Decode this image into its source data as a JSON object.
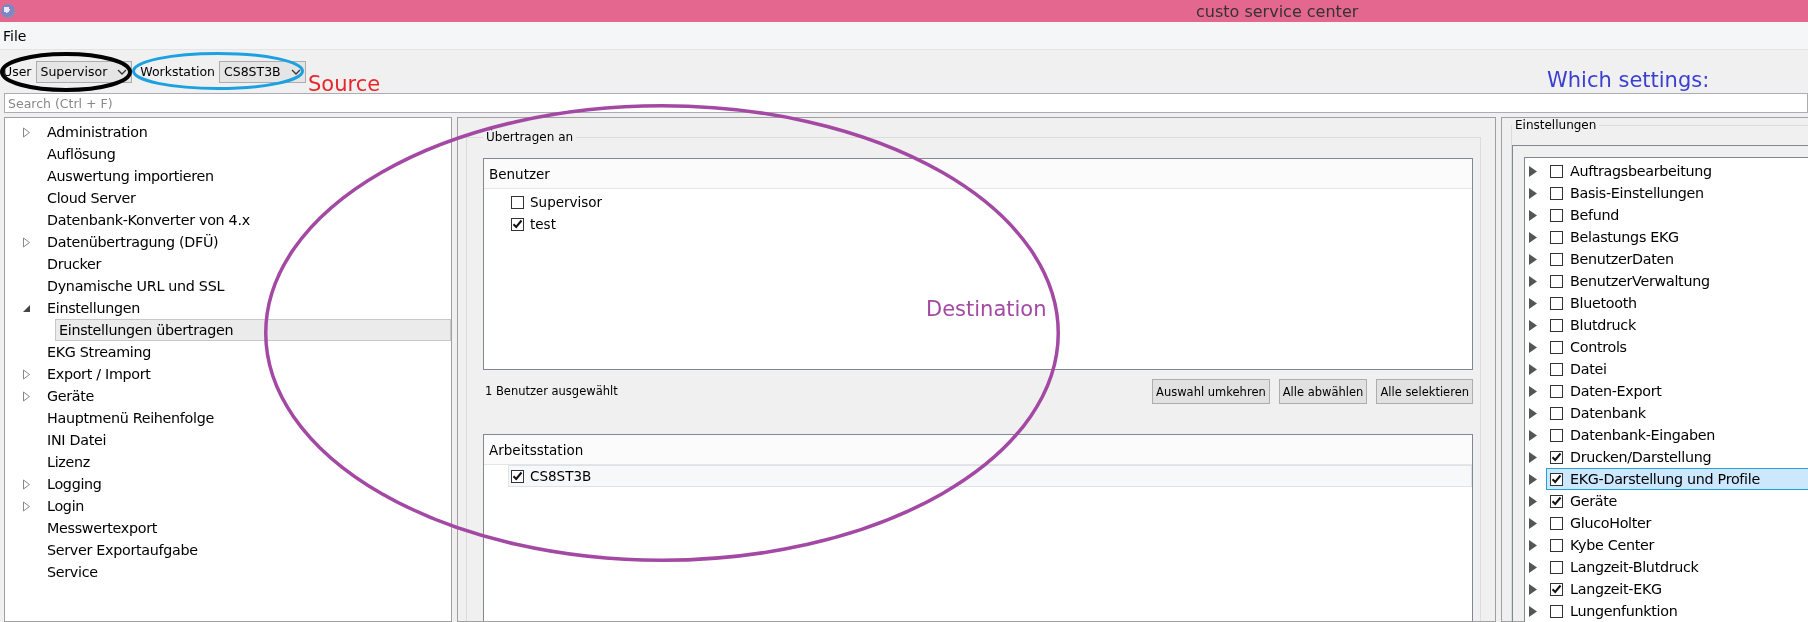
{
  "window": {
    "title": "custo service center"
  },
  "menu": [
    "File"
  ],
  "toolbar": {
    "user_label": "User",
    "user_value": "Supervisor",
    "workstation_label": "Workstation",
    "workstation_value": "CS8ST3B"
  },
  "search": {
    "placeholder": "Search (Ctrl + F)"
  },
  "sidebar": {
    "items": [
      {
        "label": "Administration",
        "expanded": false,
        "selected": false
      },
      {
        "label": "Auflösung",
        "selected": false
      },
      {
        "label": "Auswertung importieren",
        "selected": false
      },
      {
        "label": "Cloud Server",
        "selected": false
      },
      {
        "label": "Datenbank-Konverter von 4.x",
        "selected": false
      },
      {
        "label": "Datenübertragung (DFÜ)",
        "expanded": false,
        "selected": false
      },
      {
        "label": "Drucker",
        "selected": false
      },
      {
        "label": "Dynamische URL und SSL",
        "selected": false
      },
      {
        "label": "Einstellungen",
        "expanded": true,
        "selected": false,
        "children": [
          {
            "label": "Einstellungen übertragen",
            "selected": true
          }
        ]
      },
      {
        "label": "EKG Streaming",
        "selected": false
      },
      {
        "label": "Export / Import",
        "expanded": false,
        "selected": false
      },
      {
        "label": "Geräte",
        "expanded": false,
        "selected": false
      },
      {
        "label": "Hauptmenü Reihenfolge",
        "selected": false
      },
      {
        "label": "INI Datei",
        "selected": false
      },
      {
        "label": "Lizenz",
        "selected": false
      },
      {
        "label": "Logging",
        "expanded": false,
        "selected": false
      },
      {
        "label": "Login",
        "expanded": false,
        "selected": false
      },
      {
        "label": "Messwertexport",
        "selected": false
      },
      {
        "label": "Server Exportaufgabe",
        "selected": false
      },
      {
        "label": "Service",
        "selected": false
      }
    ]
  },
  "transfer": {
    "title": "Übertragen an",
    "users": {
      "header": "Benutzer",
      "items": [
        {
          "label": "Supervisor",
          "checked": false
        },
        {
          "label": "test",
          "checked": true
        }
      ]
    },
    "status": "1 Benutzer ausgewählt",
    "buttons": [
      "Auswahl umkehren",
      "Alle abwählen",
      "Alle selektieren"
    ],
    "workstations": {
      "header": "Arbeitsstation",
      "items": [
        {
          "label": "CS8ST3B",
          "checked": true,
          "selected": true
        }
      ]
    }
  },
  "settings": {
    "title": "Einstellungen",
    "items": [
      {
        "label": "Auftragsbearbeitung",
        "checked": false,
        "selected": false
      },
      {
        "label": "Basis-Einstellungen",
        "checked": false,
        "selected": false
      },
      {
        "label": "Befund",
        "checked": false,
        "selected": false
      },
      {
        "label": "Belastungs EKG",
        "checked": false,
        "selected": false
      },
      {
        "label": "BenutzerDaten",
        "checked": false,
        "selected": false
      },
      {
        "label": "BenutzerVerwaltung",
        "checked": false,
        "selected": false
      },
      {
        "label": "Bluetooth",
        "checked": false,
        "selected": false
      },
      {
        "label": "Blutdruck",
        "checked": false,
        "selected": false
      },
      {
        "label": "Controls",
        "checked": false,
        "selected": false
      },
      {
        "label": "Datei",
        "checked": false,
        "selected": false
      },
      {
        "label": "Daten-Export",
        "checked": false,
        "selected": false
      },
      {
        "label": "Datenbank",
        "checked": false,
        "selected": false
      },
      {
        "label": "Datenbank-Eingaben",
        "checked": false,
        "selected": false
      },
      {
        "label": "Drucken/Darstellung",
        "checked": true,
        "selected": false
      },
      {
        "label": "EKG-Darstellung und Profile",
        "checked": true,
        "selected": true
      },
      {
        "label": "Geräte",
        "checked": true,
        "selected": false
      },
      {
        "label": "GlucoHolter",
        "checked": false,
        "selected": false
      },
      {
        "label": "Kybe Center",
        "checked": false,
        "selected": false
      },
      {
        "label": "Langzeit-Blutdruck",
        "checked": false,
        "selected": false
      },
      {
        "label": "Langzeit-EKG",
        "checked": true,
        "selected": false
      },
      {
        "label": "Lungenfunktion",
        "checked": false,
        "selected": false
      }
    ]
  },
  "annotations": [
    {
      "kind": "ellipse",
      "color": "#000000"
    },
    {
      "kind": "ellipse",
      "color": "#1ba1e2"
    },
    {
      "kind": "text",
      "text": "Source",
      "color": "#e8262a"
    },
    {
      "kind": "text",
      "text": "Which settings:",
      "color": "#3a3fd0"
    },
    {
      "kind": "ellipse",
      "color": "#a349a4"
    },
    {
      "kind": "text",
      "text": "Destination",
      "color": "#a349a4"
    }
  ]
}
